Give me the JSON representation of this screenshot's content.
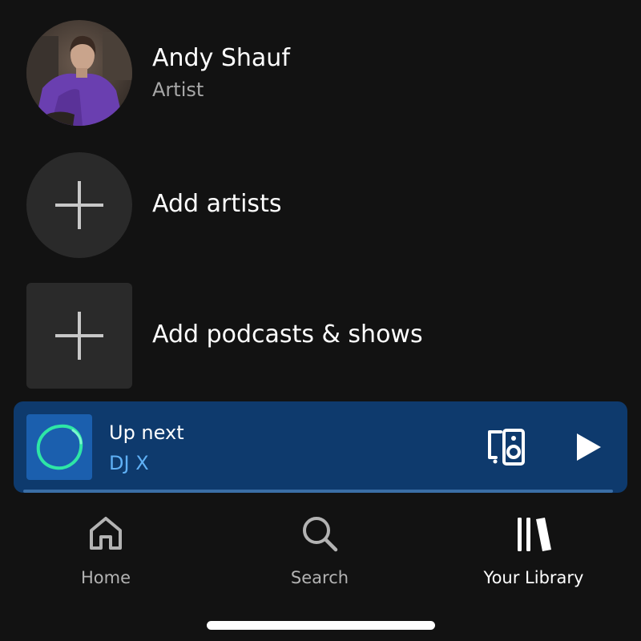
{
  "library": {
    "items": [
      {
        "title": "Andy Shauf",
        "subtitle": "Artist",
        "thumb_shape": "circle",
        "thumb_type": "artist-photo"
      },
      {
        "title": "Add artists",
        "thumb_shape": "circle",
        "thumb_icon": "plus-icon"
      },
      {
        "title": "Add podcasts & shows",
        "thumb_shape": "square",
        "thumb_icon": "plus-icon"
      }
    ]
  },
  "mini_player": {
    "title": "Up next",
    "subtitle": "DJ X",
    "art_icon": "dj-x-icon",
    "device_icon": "connect-device-icon",
    "play_icon": "play-icon",
    "progress": 0,
    "background_color": "#0e3a6d",
    "subtitle_color": "#5fb0f5"
  },
  "nav": {
    "items": [
      {
        "label": "Home",
        "icon": "home-icon",
        "active": false
      },
      {
        "label": "Search",
        "icon": "search-icon",
        "active": false
      },
      {
        "label": "Your Library",
        "icon": "library-icon",
        "active": true
      }
    ]
  },
  "colors": {
    "background": "#121212",
    "text_primary": "#ffffff",
    "text_secondary": "#a7a7a7",
    "placeholder_tile": "#2a2a2a"
  }
}
